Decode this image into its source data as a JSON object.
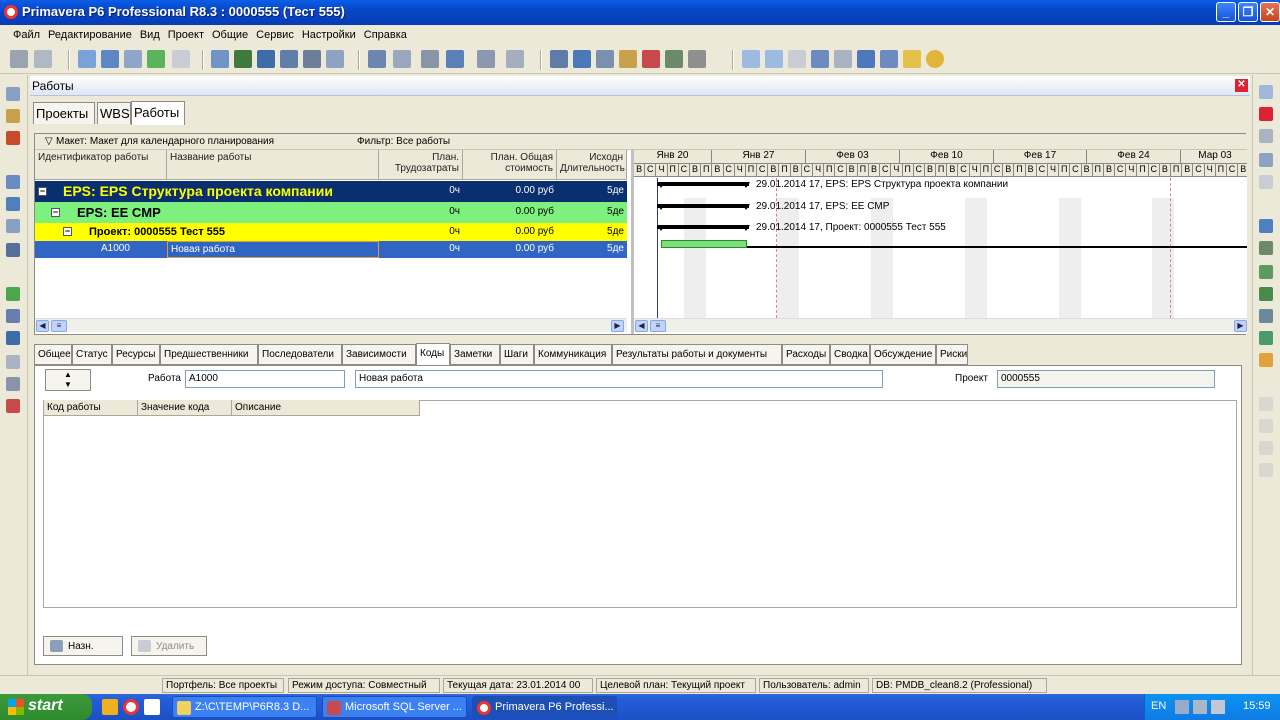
{
  "window": {
    "title": "Primavera P6 Professional R8.3 : 0000555 (Тест 555)"
  },
  "menu": [
    "Файл",
    "Редактирование",
    "Вид",
    "Проект",
    "Общие",
    "Сервис",
    "Настройки",
    "Справка"
  ],
  "panel": {
    "title": "Работы",
    "tabs": [
      "Проекты",
      "WBS",
      "Работы"
    ],
    "active_tab": "Работы"
  },
  "grid": {
    "layout": "Макет: Макет для календарного планирования",
    "filter": "Фильтр: Все работы",
    "columns": {
      "id": "Идентификатор работы",
      "name": "Название работы",
      "labor": "План. Трудозатраты",
      "cost": "План. Общая стоимость",
      "dur": "Исходн Длительность"
    },
    "rows": [
      {
        "id": "",
        "name": "EPS: EPS  Структура проекта компании",
        "labor": "0ч",
        "cost": "0.00 руб",
        "dur": "5де",
        "expander": "−"
      },
      {
        "id": "",
        "name": "EPS: EE  CMP",
        "labor": "0ч",
        "cost": "0.00 руб",
        "dur": "5де",
        "expander": "−"
      },
      {
        "id": "",
        "name": "Проект: 0000555  Тест 555",
        "labor": "0ч",
        "cost": "0.00 руб",
        "dur": "5де",
        "expander": "−"
      },
      {
        "id": "A1000",
        "name": "Новая работа",
        "labor": "0ч",
        "cost": "0.00 руб",
        "dur": "5де"
      }
    ]
  },
  "gantt": {
    "months": [
      "Янв 20",
      "Янв 27",
      "Фев 03",
      "Фев 10",
      "Фев 17",
      "Фев 24",
      "Мар 03"
    ],
    "days": [
      "В",
      "С",
      "Ч",
      "П",
      "С",
      "В",
      "П",
      "В",
      "С",
      "Ч",
      "П",
      "С",
      "В",
      "П",
      "В",
      "С",
      "Ч",
      "П",
      "С",
      "В",
      "П",
      "В",
      "С",
      "Ч",
      "П",
      "С",
      "В",
      "П",
      "В",
      "С",
      "Ч",
      "П",
      "С",
      "В",
      "П",
      "В",
      "С",
      "Ч",
      "П",
      "С",
      "В",
      "П",
      "В",
      "С",
      "Ч",
      "П",
      "С",
      "В",
      "П",
      "В",
      "С",
      "Ч",
      "П",
      "С",
      "В"
    ],
    "labels": [
      "29.01.2014 17, EPS: EPS  Структура проекта компании",
      "29.01.2014 17, EPS: EE  CMP",
      "29.01.2014 17, Проект: 0000555  Тест 555"
    ]
  },
  "details": {
    "tabs": [
      "Общее",
      "Статус",
      "Ресурсы",
      "Предшественники",
      "Последователи",
      "Зависимости",
      "Коды",
      "Заметки",
      "Шаги",
      "Коммуникация",
      "Результаты работы и документы",
      "Расходы",
      "Сводка",
      "Обсуждение",
      "Риски"
    ],
    "active_tab": "Коды",
    "activity_label": "Работа",
    "activity_id": "A1000",
    "activity_name": "Новая работа",
    "project_label": "Проект",
    "project_id": "0000555",
    "code_columns": [
      "Код работы",
      "Значение кода",
      "Описание"
    ],
    "assign_button": "Назн.",
    "remove_button": "Удалить"
  },
  "status": [
    "Портфель: Все проекты",
    "Режим доступа: Совместный",
    "Текущая дата: 23.01.2014 00",
    "Целевой план: Текущий проект",
    "Пользователь: admin",
    "DB: PMDB_clean8.2 (Professional)"
  ],
  "taskbar": {
    "start": "start",
    "tasks": [
      "Z:\\C\\TEMP\\P6R8.3 D...",
      "Microsoft SQL Server ...",
      "Primavera P6 Professi..."
    ],
    "lang": "EN",
    "clock": "15:59"
  },
  "colors": {
    "eps_row": "#0a2f6e",
    "eps_text": "#ffff00",
    "ee_row": "#7df07d",
    "project_row": "#ffff00",
    "selected_row": "#3165c5",
    "bar": "#7de07d"
  }
}
